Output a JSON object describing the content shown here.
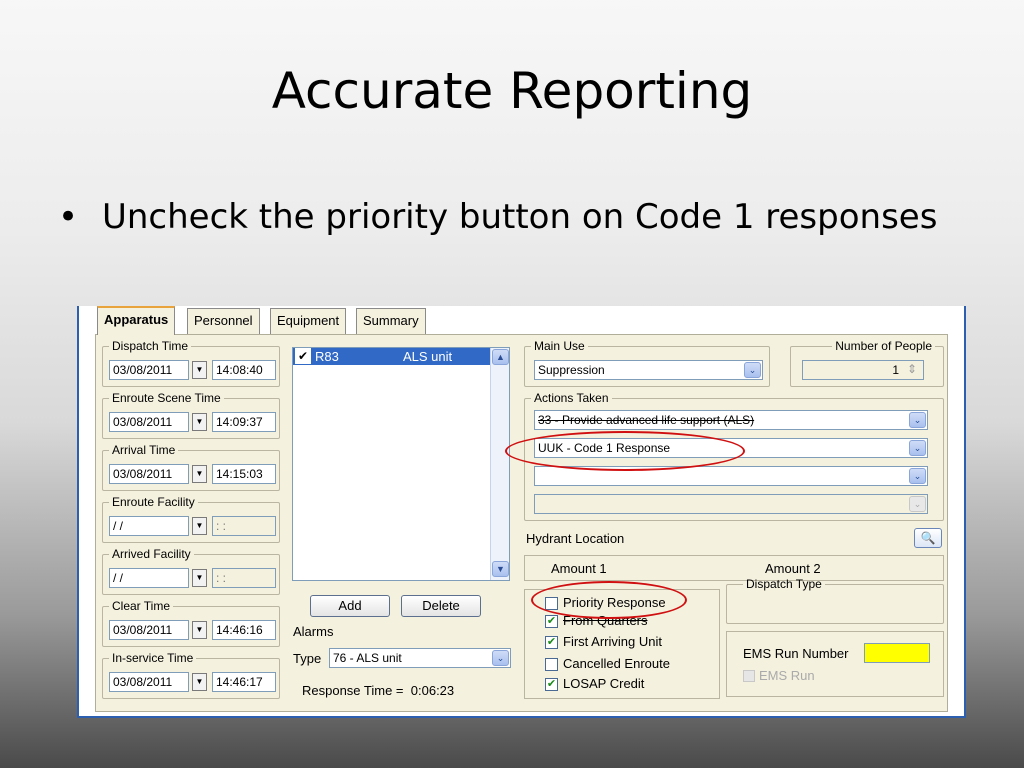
{
  "slide": {
    "title": "Accurate Reporting",
    "bullet_symbol": "•",
    "bullet": "Uncheck the priority button on Code 1 responses"
  },
  "tabs": [
    "Apparatus",
    "Personnel",
    "Equipment",
    "Summary"
  ],
  "times": {
    "dispatch": {
      "label": "Dispatch Time",
      "date": "03/08/2011",
      "time": "14:08:40"
    },
    "enroute_scene": {
      "label": "Enroute Scene Time",
      "date": "03/08/2011",
      "time": "14:09:37"
    },
    "arrival": {
      "label": "Arrival Time",
      "date": "03/08/2011",
      "time": "14:15:03"
    },
    "enroute_facility": {
      "label": "Enroute Facility",
      "date": " / /",
      "time": " : :"
    },
    "arrived_facility": {
      "label": "Arrived Facility",
      "date": " / /",
      "time": " : :"
    },
    "clear": {
      "label": "Clear Time",
      "date": "03/08/2011",
      "time": "14:46:16"
    },
    "inservice": {
      "label": "In-service Time",
      "date": "03/08/2011",
      "time": "14:46:17"
    }
  },
  "unit_list": {
    "check": "✔",
    "unit": "R83",
    "type": "ALS unit"
  },
  "buttons": {
    "add": "Add",
    "delete": "Delete"
  },
  "alarms": {
    "label": "Alarms",
    "type_label": "Type",
    "type_value": "76 - ALS unit"
  },
  "response_time": {
    "label": "Response Time =",
    "value": "0:06:23"
  },
  "main_use": {
    "label": "Main Use",
    "value": "Suppression"
  },
  "people": {
    "label": "Number of People",
    "value": "1"
  },
  "actions": {
    "label": "Actions Taken",
    "items": [
      "33 - Provide advanced life support (ALS)",
      "UUK - Code 1 Response",
      "",
      ""
    ]
  },
  "hydrant": {
    "label": "Hydrant Location"
  },
  "amounts": {
    "a1": "Amount 1",
    "a2": "Amount 2"
  },
  "checkboxes": [
    {
      "label": "Priority Response",
      "checked": false
    },
    {
      "label": "From Quarters",
      "checked": true
    },
    {
      "label": "First Arriving Unit",
      "checked": true
    },
    {
      "label": "Cancelled Enroute",
      "checked": false
    },
    {
      "label": "LOSAP Credit",
      "checked": true
    }
  ],
  "dispatch_type": {
    "label": "Dispatch Type"
  },
  "ems": {
    "run_number_label": "EMS Run Number",
    "run_label": "EMS Run"
  },
  "icons": {
    "dropdown": "▼",
    "combo": "⌄",
    "scroll_up": "▲",
    "scroll_down": "▼",
    "spin": "⇕",
    "search": "🔍"
  },
  "colors": {
    "highlight_yellow": "#ffff00",
    "annotation_red": "#d01010",
    "list_selection": "#3169c6"
  }
}
